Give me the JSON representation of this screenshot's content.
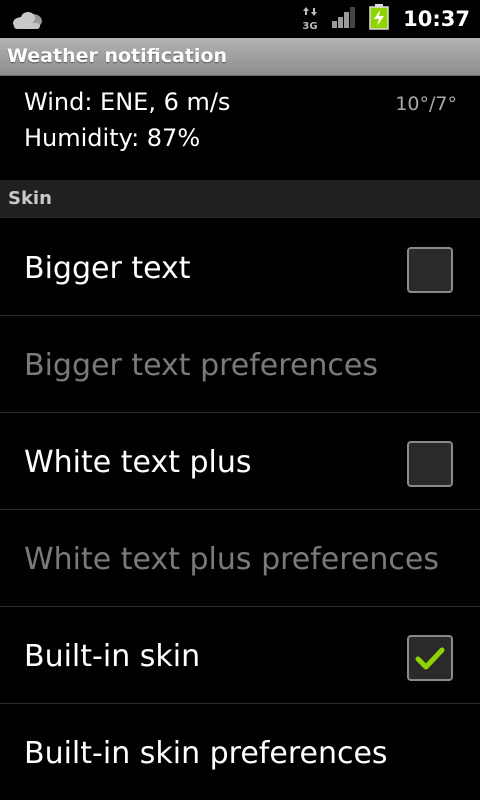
{
  "status_bar": {
    "time": "10:37",
    "network_label": "3G",
    "icons": [
      "weather-cloud-icon",
      "network-3g-icon",
      "signal-icon",
      "battery-charging-icon"
    ]
  },
  "header": {
    "title": "Weather notification"
  },
  "notification": {
    "wind": "Wind: ENE, 6 m/s",
    "humidity": "Humidity: 87%",
    "temperature": "10°/7°"
  },
  "category": {
    "title": "Skin"
  },
  "preferences": [
    {
      "label": "Bigger text",
      "enabled": true,
      "has_checkbox": true,
      "checked": false
    },
    {
      "label": "Bigger text preferences",
      "enabled": false,
      "has_checkbox": false
    },
    {
      "label": "White text plus",
      "enabled": true,
      "has_checkbox": true,
      "checked": false
    },
    {
      "label": "White text plus preferences",
      "enabled": false,
      "has_checkbox": false
    },
    {
      "label": "Built-in skin",
      "enabled": true,
      "has_checkbox": true,
      "checked": true
    },
    {
      "label": "Built-in skin preferences",
      "enabled": true,
      "has_checkbox": false
    }
  ],
  "colors": {
    "check_mark": "#8fd400",
    "disabled_text": "#7a7a7a",
    "battery": "#8fd400"
  }
}
